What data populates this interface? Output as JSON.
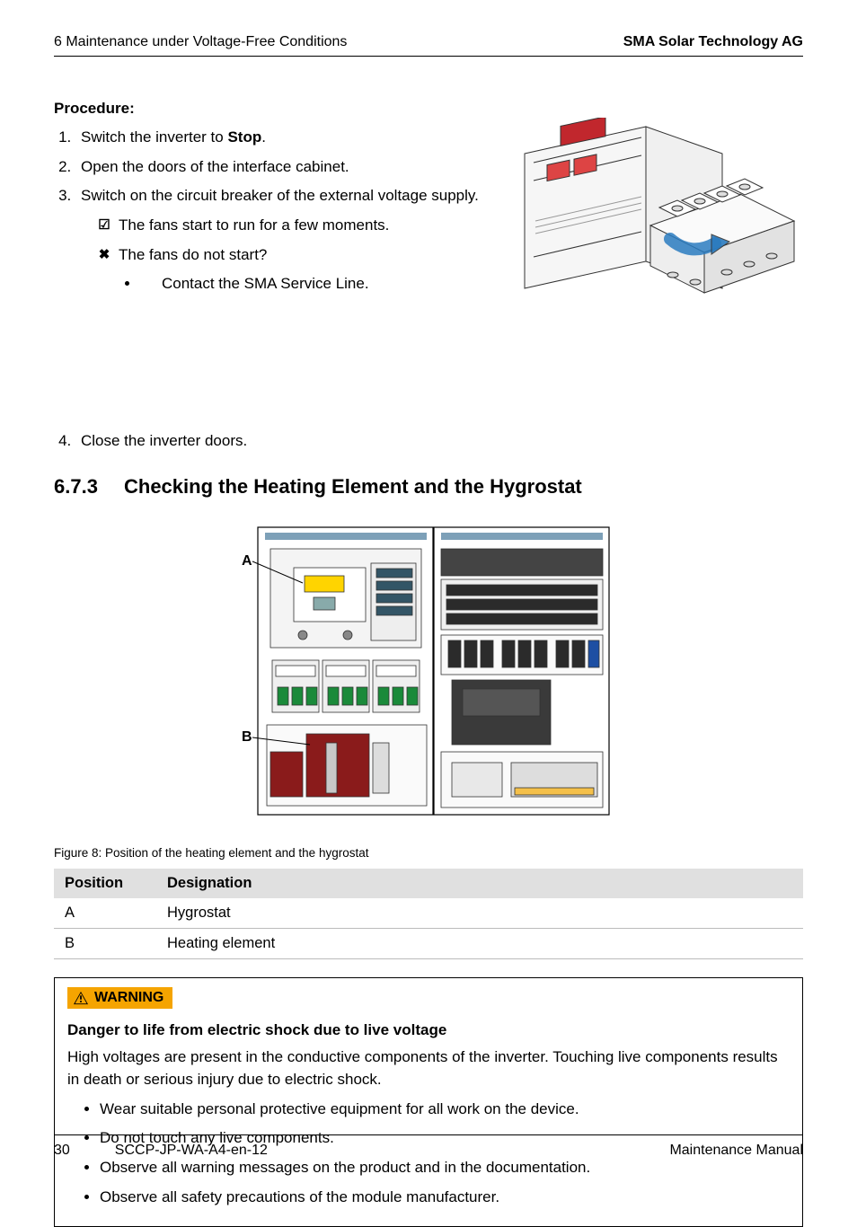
{
  "header": {
    "left": "6  Maintenance under Voltage-Free Conditions",
    "right": "SMA Solar Technology AG"
  },
  "procedure": {
    "label": "Procedure:",
    "steps": [
      {
        "pre": "Switch the inverter to ",
        "bold": "Stop",
        "post": "."
      },
      {
        "text": "Open the doors of the interface cabinet."
      },
      {
        "text": "Switch on the circuit breaker of the external voltage supply.",
        "check_ok": "The fans start to run for a few moments.",
        "check_fail": "The fans do not start?",
        "fail_action": "Contact the SMA Service Line."
      },
      {
        "text": "Close the inverter doors."
      }
    ]
  },
  "section": {
    "number": "6.7.3",
    "title": "Checking the Heating Element and the Hygrostat"
  },
  "figure": {
    "labelA": "A",
    "labelB": "B",
    "caption": "Figure 8:   Position of the heating element and the hygrostat"
  },
  "table": {
    "headers": {
      "pos": "Position",
      "des": "Designation"
    },
    "rows": [
      {
        "pos": "A",
        "des": "Hygrostat"
      },
      {
        "pos": "B",
        "des": "Heating element"
      }
    ]
  },
  "warning": {
    "tag": "WARNING",
    "title": "Danger to life from electric shock due to live voltage",
    "body": "High voltages are present in the conductive components of the inverter. Touching live components results in death or serious injury due to electric shock.",
    "items": [
      "Wear suitable personal protective equipment for all work on the device.",
      "Do not touch any live components.",
      "Observe all warning messages on the product and in the documentation.",
      "Observe all safety precautions of the module manufacturer."
    ]
  },
  "footer": {
    "page": "30",
    "doc": "SCCP-JP-WA-A4-en-12",
    "type": "Maintenance Manual"
  }
}
